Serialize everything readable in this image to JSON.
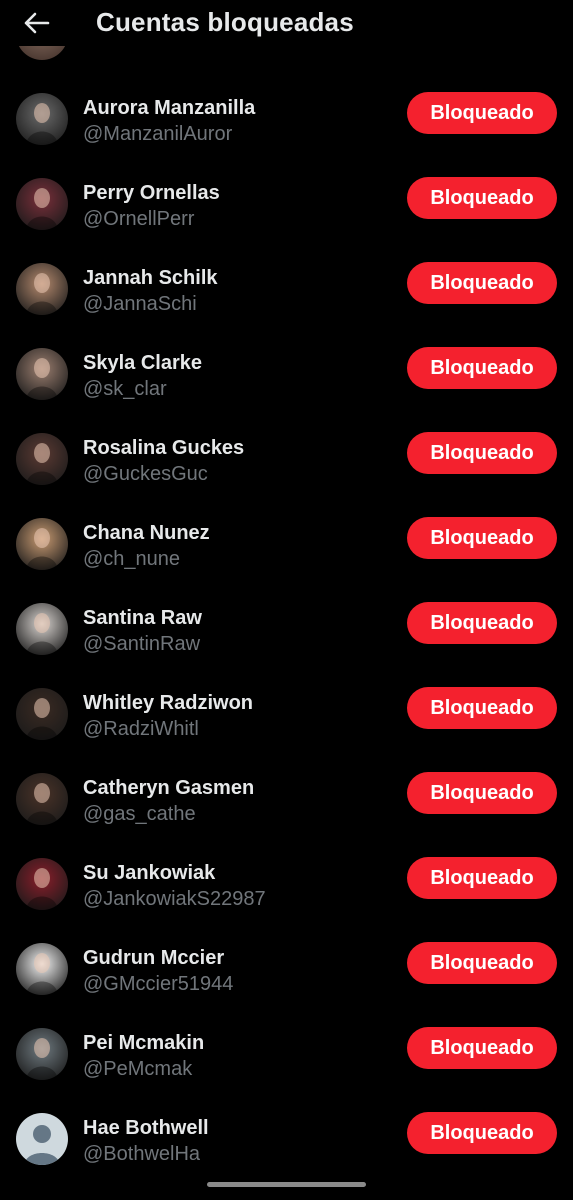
{
  "header": {
    "title": "Cuentas bloqueadas",
    "back_icon": "arrow-left-icon"
  },
  "colors": {
    "background": "#000000",
    "primary_text": "#e7e9ea",
    "secondary_text": "#71767b",
    "blocked_button": "#f4212e"
  },
  "accounts": [
    {
      "name": "Aurora Manzanilla",
      "handle": "@ManzanilAuror",
      "button": "Bloqueado",
      "avatar_color": "#6b6b6b"
    },
    {
      "name": "Perry Ornellas",
      "handle": "@OrnellPerr",
      "button": "Bloqueado",
      "avatar_color": "#7a2f3a"
    },
    {
      "name": "Jannah Schilk",
      "handle": "@JannaSchi",
      "button": "Bloqueado",
      "avatar_color": "#b58a6e"
    },
    {
      "name": "Skyla Clarke",
      "handle": "@sk_clar",
      "button": "Bloqueado",
      "avatar_color": "#9c7f70"
    },
    {
      "name": "Rosalina Guckes",
      "handle": "@GuckesGuc",
      "button": "Bloqueado",
      "avatar_color": "#5b3a33"
    },
    {
      "name": "Chana Nunez",
      "handle": "@ch_nune",
      "button": "Bloqueado",
      "avatar_color": "#c99b72"
    },
    {
      "name": "Santina Raw",
      "handle": "@SantinRaw",
      "button": "Bloqueado",
      "avatar_color": "#d9d4d0"
    },
    {
      "name": "Whitley Radziwon",
      "handle": "@RadziWhitl",
      "button": "Bloqueado",
      "avatar_color": "#3a2a22"
    },
    {
      "name": "Catheryn Gasmen",
      "handle": "@gas_cathe",
      "button": "Bloqueado",
      "avatar_color": "#4a3328"
    },
    {
      "name": "Su Jankowiak",
      "handle": "@JankowiakS22987",
      "button": "Bloqueado",
      "avatar_color": "#8a1e2a"
    },
    {
      "name": "Gudrun Mccier",
      "handle": "@GMccier51944",
      "button": "Bloqueado",
      "avatar_color": "#f2f2f2"
    },
    {
      "name": "Pei Mcmakin",
      "handle": "@PeMcmak",
      "button": "Bloqueado",
      "avatar_color": "#6f7a80"
    },
    {
      "name": "Hae Bothwell",
      "handle": "@BothwelHa",
      "button": "Bloqueado",
      "avatar_color": "#cfd9de",
      "default_avatar": true
    }
  ]
}
